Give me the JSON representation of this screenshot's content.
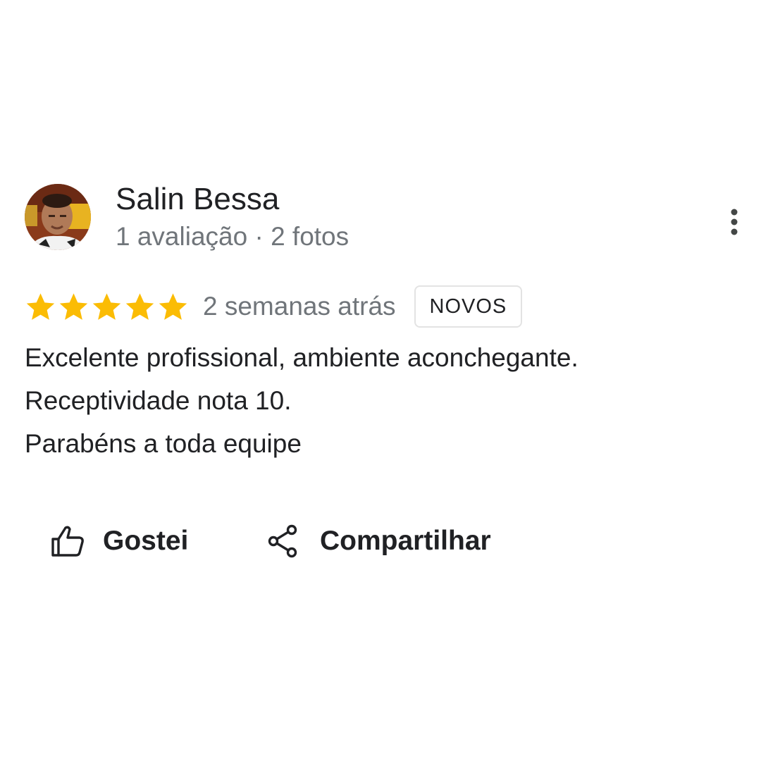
{
  "review": {
    "author": {
      "name": "Salin Bessa",
      "meta": "1 avaliação · 2 fotos",
      "avatar_icon": "profile-photo-avatar"
    },
    "menu_icon": "more-vert-icon",
    "rating": {
      "stars": 5,
      "max": 5,
      "star_color": "#fbbc04",
      "star_icon": "star-icon"
    },
    "date": "2 semanas atrás",
    "badge": "NOVOS",
    "text_lines": [
      "Excelente profissional, ambiente aconchegante.",
      "Receptividade nota 10.",
      "Parabéns a toda equipe"
    ],
    "actions": {
      "like": {
        "label": "Gostei",
        "icon": "thumb-up-icon"
      },
      "share": {
        "label": "Compartilhar",
        "icon": "share-icon"
      }
    }
  },
  "colors": {
    "text_primary": "#202124",
    "text_secondary": "#70757a",
    "star": "#fbbc04",
    "badge_border": "#e3e3e3"
  }
}
